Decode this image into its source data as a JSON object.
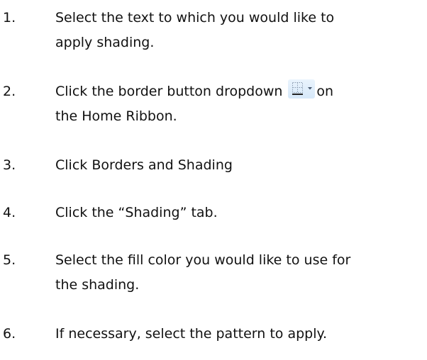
{
  "steps": [
    {
      "number": "1.",
      "line1": "Select the text to which you would like to",
      "line2": "apply shading."
    },
    {
      "number": "2.",
      "line1_before": "Click the border button dropdown",
      "line1_after": "on",
      "line2": "the Home Ribbon.",
      "icon": "border-button-dropdown-icon"
    },
    {
      "number": "3.",
      "line1": "Click Borders and Shading"
    },
    {
      "number": "4.",
      "line1": "Click the “Shading” tab."
    },
    {
      "number": "5.",
      "line1": "Select the fill color you would like to use for",
      "line2": "the shading."
    },
    {
      "number": "6.",
      "line1": "If necessary, select the pattern to apply."
    }
  ]
}
